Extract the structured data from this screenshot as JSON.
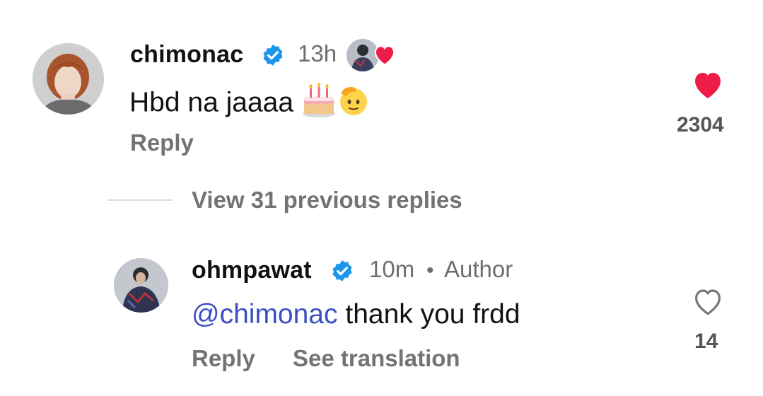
{
  "comment": {
    "username": "chimonac",
    "time": "13h",
    "text": "Hbd na jaaaa",
    "reply_label": "Reply",
    "like_count": "2304",
    "liked": true,
    "like_color": "#ed1d48"
  },
  "view_replies": {
    "label": "View 31 previous replies"
  },
  "reply": {
    "username": "ohmpawat",
    "time": "10m",
    "separator": "•",
    "author_badge": "Author",
    "mention": "@chimonac",
    "text": "thank you frdd",
    "reply_label": "Reply",
    "translate_label": "See translation",
    "like_count": "14",
    "liked": false
  },
  "icons": {
    "verified": "verified-badge-icon",
    "heart_filled": "heart-filled-icon",
    "heart_outline": "heart-outline-icon",
    "cake": "birthday-cake-emoji",
    "saluting": "saluting-face-emoji",
    "mention_at": "threads-at-icon"
  },
  "colors": {
    "verified_blue": "#1c96e8",
    "mention_blue": "#3b4fc4",
    "muted_text": "#737373"
  }
}
